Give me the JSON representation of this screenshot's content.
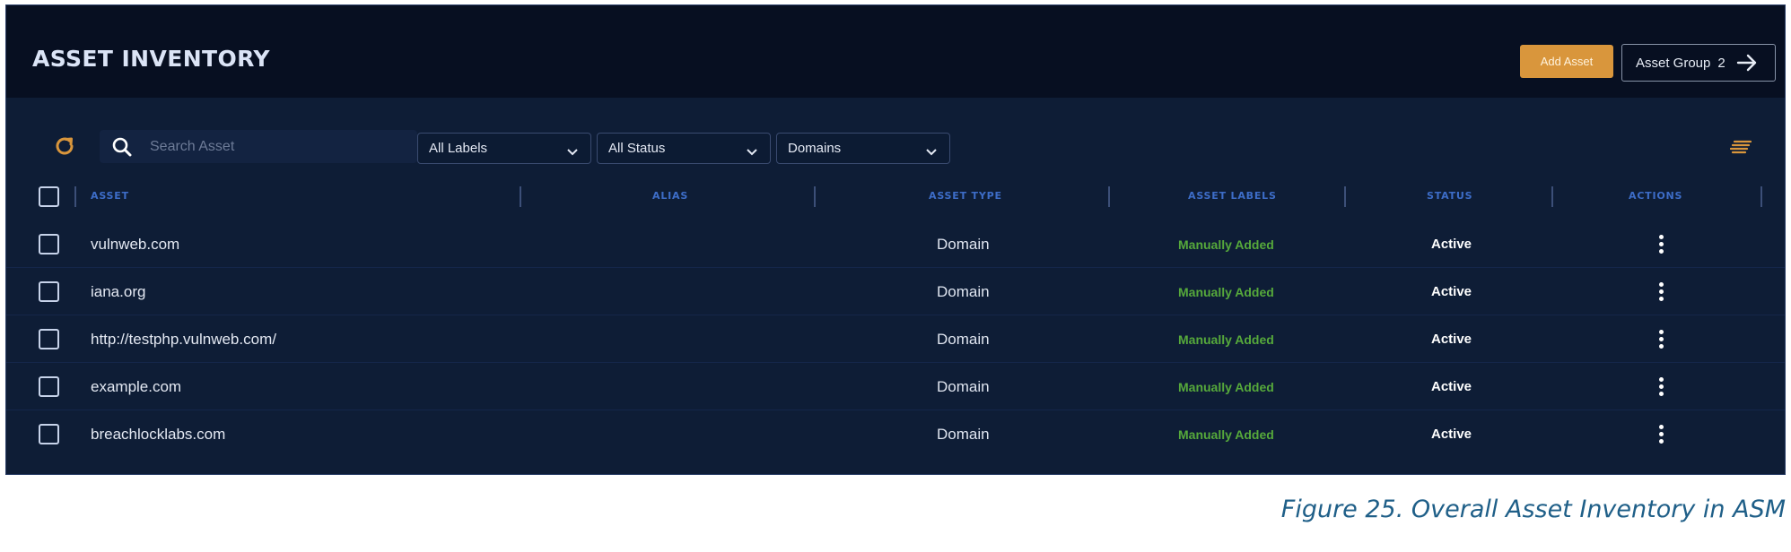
{
  "header": {
    "title": "ASSET INVENTORY",
    "add_asset_label": "Add Asset",
    "asset_group_label": "Asset Group",
    "asset_group_count": "2"
  },
  "toolbar": {
    "search_placeholder": "Search Asset",
    "filters": {
      "labels": "All Labels",
      "status": "All Status",
      "type": "Domains"
    }
  },
  "table": {
    "columns": [
      "ASSET",
      "ALIAS",
      "ASSET TYPE",
      "ASSET LABELS",
      "STATUS",
      "ACTIONS"
    ],
    "rows": [
      {
        "asset": "vulnweb.com",
        "alias": "",
        "type": "Domain",
        "label": "Manually Added",
        "status": "Active"
      },
      {
        "asset": "iana.org",
        "alias": "",
        "type": "Domain",
        "label": "Manually Added",
        "status": "Active"
      },
      {
        "asset": "http://testphp.vulnweb.com/",
        "alias": "",
        "type": "Domain",
        "label": "Manually Added",
        "status": "Active"
      },
      {
        "asset": "example.com",
        "alias": "",
        "type": "Domain",
        "label": "Manually Added",
        "status": "Active"
      },
      {
        "asset": "breachlocklabs.com",
        "alias": "",
        "type": "Domain",
        "label": "Manually Added",
        "status": "Active"
      }
    ]
  },
  "caption": "Figure 25. Overall Asset Inventory in ASM",
  "colors": {
    "panel_bg": "#0e1d36",
    "header_bg": "#070f21",
    "accent_orange": "#d9963c",
    "label_green": "#56a93b",
    "column_header_blue": "#3d6dc8",
    "caption_blue": "#1f5f88"
  },
  "icons": [
    "refresh-icon",
    "search-icon",
    "chevron-down-icon",
    "arrow-right-icon",
    "column-settings-icon",
    "more-vertical-icon"
  ]
}
